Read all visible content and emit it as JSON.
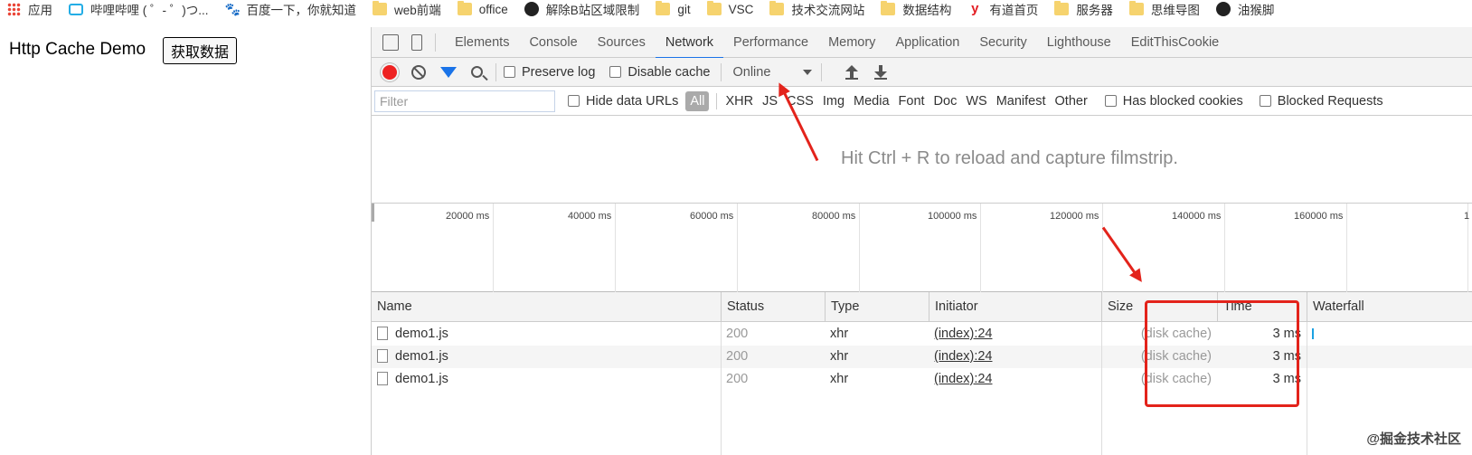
{
  "bookmarks": [
    {
      "label": "应用",
      "icon": "apps-icon"
    },
    {
      "label": "哔哩哔哩 ( ゜- ゜)つ...",
      "icon": "bilibili-icon"
    },
    {
      "label": "百度一下，你就知道",
      "icon": "baidu-icon"
    },
    {
      "label": "web前端",
      "icon": "folder-icon"
    },
    {
      "label": "office",
      "icon": "folder-icon"
    },
    {
      "label": "解除B站区域限制",
      "icon": "extension-icon"
    },
    {
      "label": "git",
      "icon": "folder-icon"
    },
    {
      "label": "VSC",
      "icon": "folder-icon"
    },
    {
      "label": "技术交流网站",
      "icon": "folder-icon"
    },
    {
      "label": "数据结构",
      "icon": "folder-icon"
    },
    {
      "label": "有道首页",
      "icon": "youdao-icon"
    },
    {
      "label": "服务器",
      "icon": "folder-icon"
    },
    {
      "label": "思维导图",
      "icon": "folder-icon"
    },
    {
      "label": "油猴脚",
      "icon": "extension-icon"
    }
  ],
  "page": {
    "title": "Http Cache Demo",
    "button": "获取数据"
  },
  "devtools": {
    "tabs": [
      "Elements",
      "Console",
      "Sources",
      "Network",
      "Performance",
      "Memory",
      "Application",
      "Security",
      "Lighthouse",
      "EditThisCookie"
    ],
    "active_tab": "Network",
    "toolbar": {
      "preserve_log": "Preserve log",
      "disable_cache": "Disable cache",
      "throttle": "Online"
    },
    "filter": {
      "placeholder": "Filter",
      "hide_data_urls": "Hide data URLs",
      "types": [
        "All",
        "XHR",
        "JS",
        "CSS",
        "Img",
        "Media",
        "Font",
        "Doc",
        "WS",
        "Manifest",
        "Other"
      ],
      "has_blocked_cookies": "Has blocked cookies",
      "blocked_requests": "Blocked Requests"
    },
    "filmstrip_hint": "Hit Ctrl + R to reload and capture filmstrip.",
    "timeline_ticks": [
      "20000 ms",
      "40000 ms",
      "60000 ms",
      "80000 ms",
      "100000 ms",
      "120000 ms",
      "140000 ms",
      "160000 ms",
      "1"
    ],
    "columns": [
      "Name",
      "Status",
      "Type",
      "Initiator",
      "Size",
      "Time",
      "Waterfall"
    ],
    "rows": [
      {
        "name": "demo1.js",
        "status": "200",
        "type": "xhr",
        "initiator": "(index):24",
        "size": "(disk cache)",
        "time": "3 ms"
      },
      {
        "name": "demo1.js",
        "status": "200",
        "type": "xhr",
        "initiator": "(index):24",
        "size": "(disk cache)",
        "time": "3 ms"
      },
      {
        "name": "demo1.js",
        "status": "200",
        "type": "xhr",
        "initiator": "(index):24",
        "size": "(disk cache)",
        "time": "3 ms"
      }
    ]
  },
  "watermark": "@掘金技术社区",
  "colors": {
    "accent": "#1a73e8",
    "record": "#ee2222",
    "annotation": "#e3231b"
  }
}
